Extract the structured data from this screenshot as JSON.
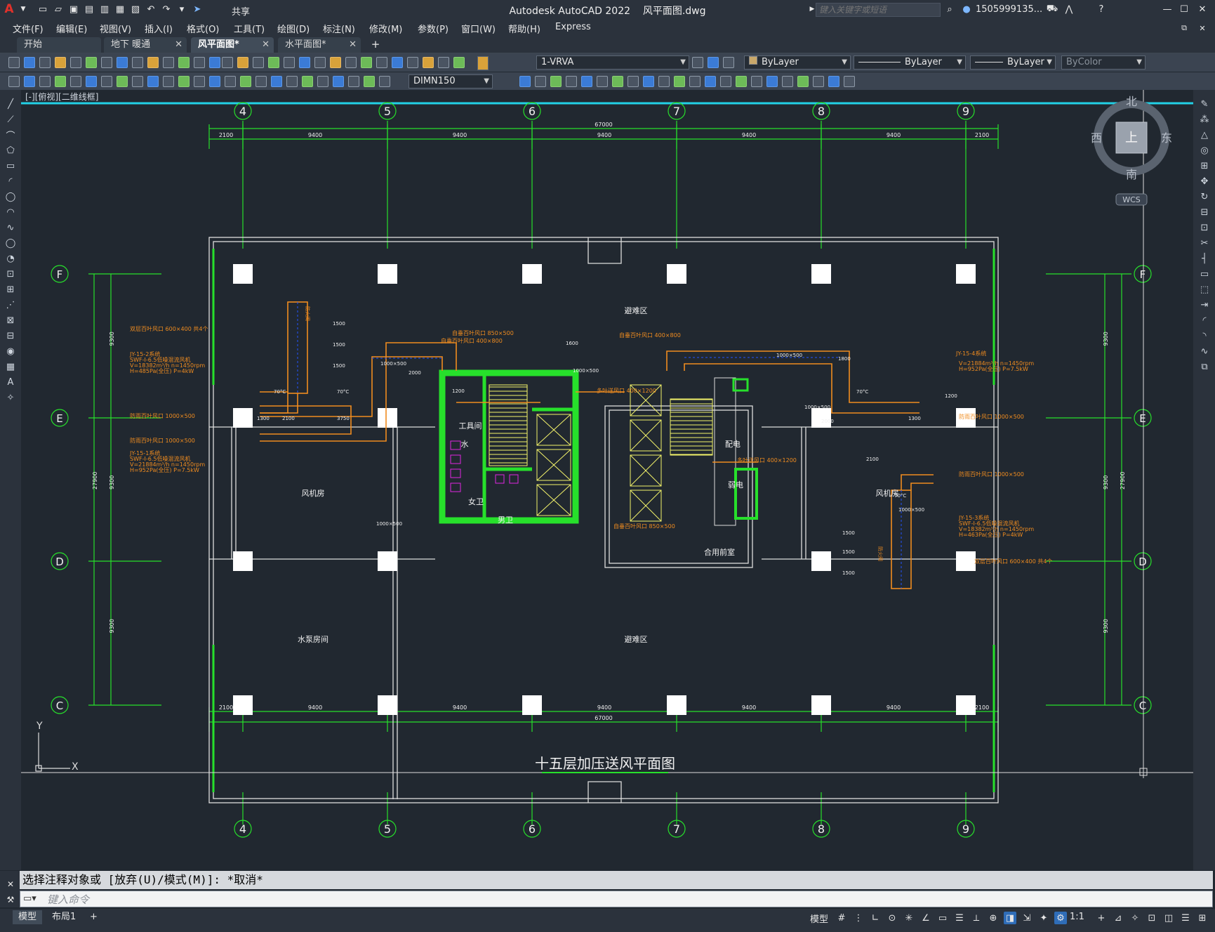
{
  "app": {
    "title": "Autodesk AutoCAD 2022",
    "file": "风平面图.dwg",
    "share": "共享",
    "search_placeholder": "键入关键字或短语",
    "user": "1505999135...",
    "logo": "A"
  },
  "menu": [
    "文件(F)",
    "编辑(E)",
    "视图(V)",
    "插入(I)",
    "格式(O)",
    "工具(T)",
    "绘图(D)",
    "标注(N)",
    "修改(M)",
    "参数(P)",
    "窗口(W)",
    "帮助(H)",
    "Express"
  ],
  "tabs": [
    {
      "label": "开始",
      "active": false,
      "closable": false
    },
    {
      "label": "地下 暖通",
      "active": false,
      "closable": true
    },
    {
      "label": "风平面图*",
      "active": true,
      "closable": true
    },
    {
      "label": "水平面图*",
      "active": false,
      "closable": true
    }
  ],
  "toolbar": {
    "layer": "1-VRVA",
    "color": "ByLayer",
    "linetype": "ByLayer",
    "lineweight": "ByLayer",
    "plotstyle": "ByColor",
    "dimstyle": "DIMN150"
  },
  "viewcube": {
    "north": "北",
    "south": "南",
    "east": "东",
    "west": "西",
    "top": "上",
    "wcs": "WCS"
  },
  "viewport_label": "[-][俯视][二维线框]",
  "drawing": {
    "title": "十五层加压送风平面图",
    "axis_cols": [
      "4",
      "5",
      "6",
      "7",
      "8",
      "9"
    ],
    "axis_rows": [
      "F",
      "E",
      "D",
      "C"
    ],
    "dims_top": [
      "2100",
      "9400",
      "9400",
      "9400",
      "9400",
      "9400",
      "2100"
    ],
    "dims_bottom": [
      "2100",
      "9400",
      "9400",
      "9400",
      "9400",
      "9400",
      "2100"
    ],
    "total_width": "67000",
    "dims_side": [
      "9300",
      "9300",
      "9300"
    ],
    "total_height": "27900",
    "rooms": [
      {
        "name": "避难区"
      },
      {
        "name": "避难区"
      },
      {
        "name": "风机房"
      },
      {
        "name": "风机房"
      },
      {
        "name": "水泵房间"
      },
      {
        "name": "工具间"
      },
      {
        "name": "水"
      },
      {
        "name": "配电"
      },
      {
        "name": "弱电"
      },
      {
        "name": "合用前室"
      },
      {
        "name": "女卫"
      },
      {
        "name": "男卫"
      }
    ],
    "annotations": [
      {
        "text": "双层百叶风口 600×400 共4个"
      },
      {
        "text": "JY-15-2系统"
      },
      {
        "text": "SWF-I-6.5低噪混流风机"
      },
      {
        "text": "V=18382m³/h n=1450rpm"
      },
      {
        "text": "H=485Pa(全压) P=4kW"
      },
      {
        "text": "防雨百叶风口 1000×500"
      },
      {
        "text": "防雨百叶风口 1000×500"
      },
      {
        "text": "JY-15-1系统"
      },
      {
        "text": "SWF-I-6.5低噪混流风机"
      },
      {
        "text": "V=21884m³/h n=1450rpm"
      },
      {
        "text": "H=952Pa(全压) P=7.5kW"
      },
      {
        "text": "JY-15-4系统"
      },
      {
        "text": "V=21884m³/h n=1450rpm"
      },
      {
        "text": "H=952Pa(全压) P=7.5kW"
      },
      {
        "text": "防雨百叶风口 1000×500"
      },
      {
        "text": "防雨百叶风口 1000×500"
      },
      {
        "text": "JY-15-3系统"
      },
      {
        "text": "SWF-I-6.5低噪混流风机"
      },
      {
        "text": "V=18382m³/h n=1450rpm"
      },
      {
        "text": "H=463Pa(全压) P=4kW"
      },
      {
        "text": "双层百叶风口 600×400 共4个"
      },
      {
        "text": "自垂百叶风口 850×500"
      },
      {
        "text": "自垂百叶风口 400×800"
      },
      {
        "text": "自垂百叶风口 400×800"
      },
      {
        "text": "多叶送风口 400×1200"
      },
      {
        "text": "多叶送风口 400×1200"
      },
      {
        "text": "自垂百叶风口 850×500"
      }
    ],
    "duct_labels": [
      "1000×500",
      "1000×500",
      "1000×500",
      "1000×500",
      "1000×500",
      "1000×500"
    ],
    "duct_dims": [
      "1500",
      "1500",
      "1500",
      "1500",
      "1500",
      "1500",
      "2000",
      "3750",
      "2100",
      "1300",
      "1300",
      "2100",
      "2000",
      "1800",
      "1600",
      "1200",
      "1200",
      "70°C",
      "70°C",
      "70°C",
      "70°C"
    ],
    "fire_dampers": [
      "防火阀",
      "防火阀"
    ]
  },
  "command": {
    "history": "选择注释对象或 [放弃(U)/模式(M)]: *取消*",
    "input_placeholder": "键入命令"
  },
  "status": {
    "layout_tabs": [
      "模型",
      "布局1"
    ],
    "model_button": "模型",
    "scale": "1:1"
  }
}
